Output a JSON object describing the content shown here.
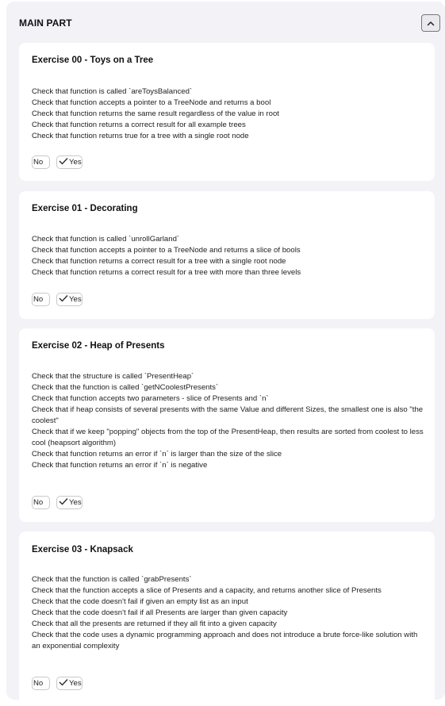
{
  "section": {
    "title": "MAIN PART",
    "collapse_icon": "chevron-up-icon"
  },
  "cards": [
    {
      "title": "Exercise 00 - Toys on a Tree",
      "items": [
        "Check that function is called `areToysBalanced`",
        "Check that function accepts a pointer to a TreeNode and returns a bool",
        "Check that function returns the same result regardless of the value in root",
        "Check that function returns a correct result for all example trees",
        "Check that function returns true for a tree with a single root node"
      ],
      "no_label": "No",
      "yes_label": "Yes"
    },
    {
      "title": "Exercise 01 - Decorating",
      "items": [
        "Check that function is called `unrollGarland`",
        "Check that function accepts a pointer to a TreeNode and returns a slice of bools",
        "Check that function returns a correct result for a tree with a single root node",
        "Check that function returns a correct result for a tree with more than three levels"
      ],
      "no_label": "No",
      "yes_label": "Yes"
    },
    {
      "title": "Exercise 02 - Heap of Presents",
      "items": [
        "Check that the structure is called `PresentHeap`",
        "Check that the function is called `getNCoolestPresents`",
        "Check that function accepts two parameters - slice of Presents and `n`",
        "Check that if heap consists of several presents with the same Value and different Sizes, the smallest one is also \"the coolest\"",
        "Check that if we keep \"popping\" objects from the top of the PresentHeap, then results are sorted from coolest to less cool (heapsort algorithm)",
        "Check that function returns an error if `n` is larger than the size of the slice",
        "Check that function returns an error if `n` is negative"
      ],
      "no_label": "No",
      "yes_label": "Yes"
    },
    {
      "title": "Exercise 03 - Knapsack",
      "items": [
        "Check that the function is called `grabPresents`",
        "Check that the function accepts a slice of Presents and a capacity, and returns another slice of Presents",
        "Check that the code doesn't fail if given an empty list as an input",
        "Check that the code doesn't fail if all Presents are larger than given capacity",
        "Check that all the presents are returned if they all fit into a given capacity",
        "Check that the code uses a dynamic programming approach and does not introduce a brute force-like solution with an exponential complexity"
      ],
      "no_label": "No",
      "yes_label": "Yes"
    }
  ]
}
